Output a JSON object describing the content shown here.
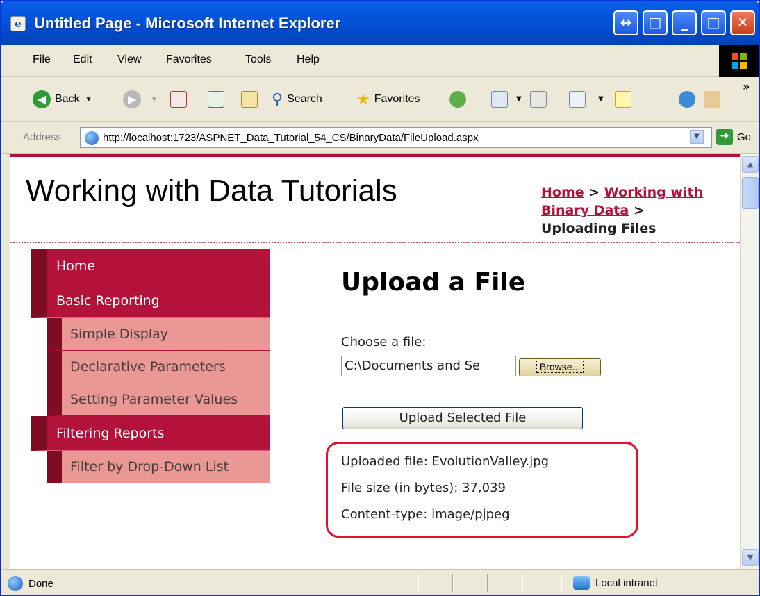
{
  "window": {
    "title": "Untitled Page - Microsoft Internet Explorer",
    "controls": {
      "restore": "↔",
      "maximize": "□",
      "minimize": "_",
      "maximize2": "□",
      "close": "✕"
    }
  },
  "menubar": {
    "items": [
      "File",
      "Edit",
      "View",
      "Favorites",
      "Tools",
      "Help"
    ]
  },
  "toolbar": {
    "back": "Back",
    "search": "Search",
    "favorites": "Favorites",
    "more": "»"
  },
  "addressbar": {
    "label": "Address",
    "url": "http://localhost:1723/ASPNET_Data_Tutorial_54_CS/BinaryData/FileUpload.aspx",
    "go": "Go"
  },
  "page": {
    "site_title": "Working with Data Tutorials",
    "breadcrumb": {
      "home": "Home",
      "sep1": " > ",
      "section": "Working with Binary Data",
      "sep2": " >",
      "current": "Uploading Files"
    },
    "sidebar": {
      "home": "Home",
      "basic_reporting": "Basic Reporting",
      "simple_display": "Simple Display",
      "declarative_parameters": "Declarative Parameters",
      "setting_parameter_values": "Setting Parameter Values",
      "filtering_reports": "Filtering Reports",
      "filter_dropdown": "Filter by Drop-Down List"
    },
    "heading": "Upload a File",
    "choose_label": "Choose a file:",
    "file_value": "C:\\Documents and Se",
    "browse_label": "Browse...",
    "upload_button": "Upload Selected File",
    "result": {
      "uploaded": "Uploaded file: EvolutionValley.jpg",
      "size": "File size (in bytes): 37,039",
      "content_type": "Content-type: image/pjpeg"
    }
  },
  "statusbar": {
    "status": "Done",
    "zone": "Local intranet"
  }
}
